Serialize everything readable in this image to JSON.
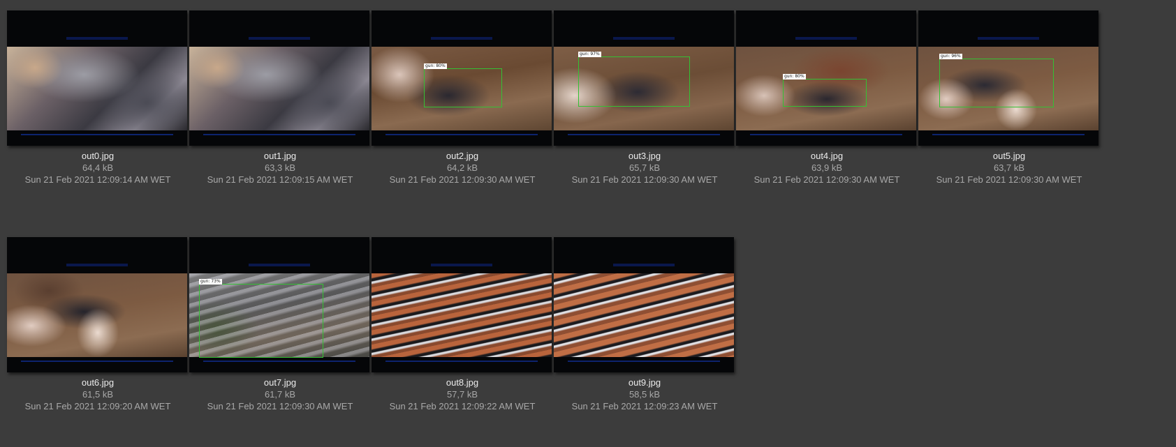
{
  "files": [
    {
      "name": "out0.jpg",
      "size": "64,4 kB",
      "date": "Sun 21 Feb 2021 12:09:14 AM WET",
      "detections": []
    },
    {
      "name": "out1.jpg",
      "size": "63,3 kB",
      "date": "Sun 21 Feb 2021 12:09:15 AM WET",
      "detections": []
    },
    {
      "name": "out2.jpg",
      "size": "64,2 kB",
      "date": "Sun 21 Feb 2021 12:09:30 AM WET",
      "detections": [
        {
          "label": "gun: 80%"
        }
      ]
    },
    {
      "name": "out3.jpg",
      "size": "65,7 kB",
      "date": "Sun 21 Feb 2021 12:09:30 AM WET",
      "detections": [
        {
          "label": "gun: 97%"
        }
      ]
    },
    {
      "name": "out4.jpg",
      "size": "63,9 kB",
      "date": "Sun 21 Feb 2021 12:09:30 AM WET",
      "detections": [
        {
          "label": "gun: 80%"
        }
      ]
    },
    {
      "name": "out5.jpg",
      "size": "63,7 kB",
      "date": "Sun 21 Feb 2021 12:09:30 AM WET",
      "detections": [
        {
          "label": "gun: 96%"
        }
      ]
    },
    {
      "name": "out6.jpg",
      "size": "61,5 kB",
      "date": "Sun 21 Feb 2021 12:09:20 AM WET",
      "detections": []
    },
    {
      "name": "out7.jpg",
      "size": "61,7 kB",
      "date": "Sun 21 Feb 2021 12:09:30 AM WET",
      "detections": [
        {
          "label": "gun: 73%"
        }
      ]
    },
    {
      "name": "out8.jpg",
      "size": "57,7 kB",
      "date": "Sun 21 Feb 2021 12:09:22 AM WET",
      "detections": []
    },
    {
      "name": "out9.jpg",
      "size": "58,5 kB",
      "date": "Sun 21 Feb 2021 12:09:23 AM WET",
      "detections": []
    }
  ],
  "colors": {
    "background": "#3c3c3c",
    "filename_text": "#ececec",
    "meta_text": "#a8a8a8",
    "detection_box": "#34c134"
  }
}
